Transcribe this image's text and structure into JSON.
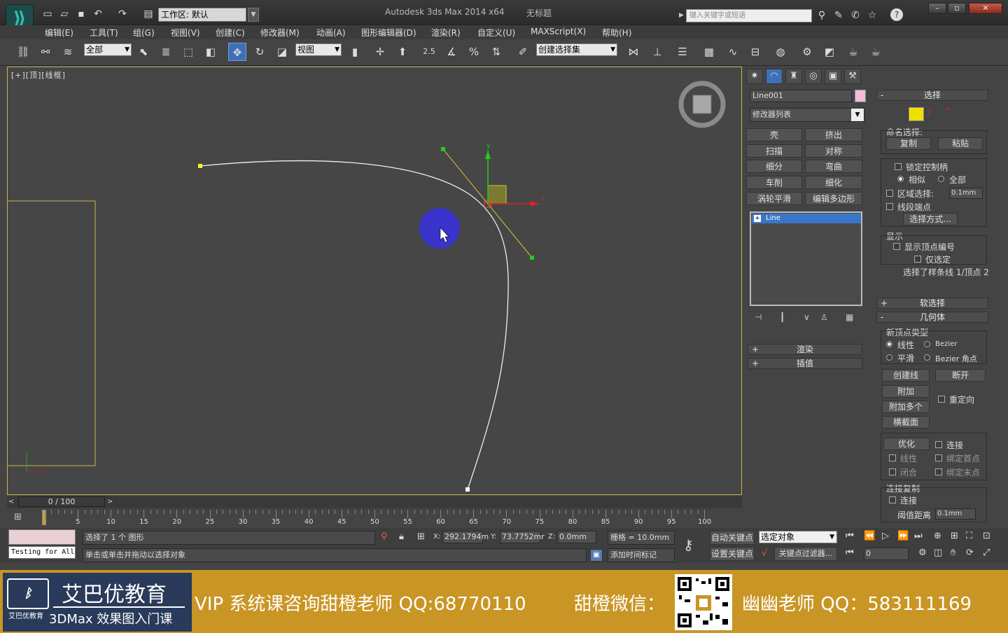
{
  "app": {
    "title": "Autodesk 3ds Max  2014 x64",
    "doc": "无标题",
    "workspace": "工作区: 默认",
    "search_placeholder": "键入关键字或短语"
  },
  "menu": [
    "编辑(E)",
    "工具(T)",
    "组(G)",
    "视图(V)",
    "创建(C)",
    "修改器(M)",
    "动画(A)",
    "图形编辑器(D)",
    "渲染(R)",
    "自定义(U)",
    "MAXScript(X)",
    "帮助(H)"
  ],
  "toolbar": {
    "filter": "全部",
    "refcoord": "视图",
    "selset": "创建选择集",
    "snap_label": "2.5",
    "pct_label": "%"
  },
  "viewport": {
    "label": "[+][顶][线框]",
    "axis_x": "x",
    "axis_y": "y"
  },
  "modify_panel": {
    "object_name": "Line001",
    "modifier_list": "修改器列表",
    "mod_buttons": [
      "壳",
      "挤出",
      "扫描",
      "对称",
      "细分",
      "弯曲",
      "车削",
      "细化",
      "涡轮平滑",
      "编辑多边形"
    ],
    "stack_item": "Line"
  },
  "rollouts": {
    "render": "渲染",
    "interp": "插值",
    "selection": "选择",
    "named_sel": "命名选择:",
    "copy": "复制",
    "paste": "粘贴",
    "lock_handles": "锁定控制柄",
    "alike": "相似",
    "all": "全部",
    "area_sel": "区域选择:",
    "area_val": "0.1mm",
    "seg_end": "线段端点",
    "select_by": "选择方式...",
    "display": "显示",
    "show_vert_num": "显示顶点编号",
    "only_selected": "仅选定",
    "sel_info": "选择了样条线 1/顶点 2",
    "soft_sel": "软选择",
    "geometry": "几何体",
    "new_vert_type": "新顶点类型",
    "linear": "线性",
    "bezier": "Bezier",
    "smooth": "平滑",
    "bezier_corner": "Bezier 角点",
    "create_line": "创建线",
    "break": "断开",
    "attach": "附加",
    "reorient": "重定向",
    "attach_mult": "附加多个",
    "cross_section": "横截面",
    "refine": "优化",
    "connect": "连接",
    "linear2": "线性",
    "bind_first": "绑定首点",
    "closed": "闭合",
    "bind_last": "绑定末点",
    "connect_copy": "连接复制",
    "connect2": "连接",
    "threshold": "阈值距离",
    "threshold_val": "0.1mm"
  },
  "timeline": {
    "slider": "0 / 100",
    "ticks": [
      "5",
      "10",
      "15",
      "20",
      "25",
      "30",
      "35",
      "40",
      "45",
      "50",
      "55",
      "60",
      "65",
      "70",
      "75",
      "80",
      "85",
      "90",
      "95",
      "100"
    ]
  },
  "status": {
    "script_listener": "Testing for All",
    "selected": "选择了 1 个 图形",
    "prompt": "单击或单击并拖动以选择对象",
    "x_label": "X:",
    "x": "292.1794m",
    "y_label": "Y:",
    "y": "73.7752mr",
    "z_label": "Z:",
    "z": "0.0mm",
    "grid": "栅格 = 10.0mm",
    "add_time_tag": "添加时间标记",
    "auto_key": "自动关键点",
    "set_key": "设置关键点",
    "key_target": "选定对象",
    "key_filters": "关键点过滤器...",
    "frame": "0"
  },
  "banner": {
    "brand": "艾巴优教育",
    "brand_small": "艾巴优教育",
    "course": "3DMax 效果图入门课",
    "vip": "VIP 系统课咨询甜橙老师 QQ:68770110",
    "wechat": "甜橙微信：",
    "teacher": "幽幽老师 QQ：583111169"
  }
}
